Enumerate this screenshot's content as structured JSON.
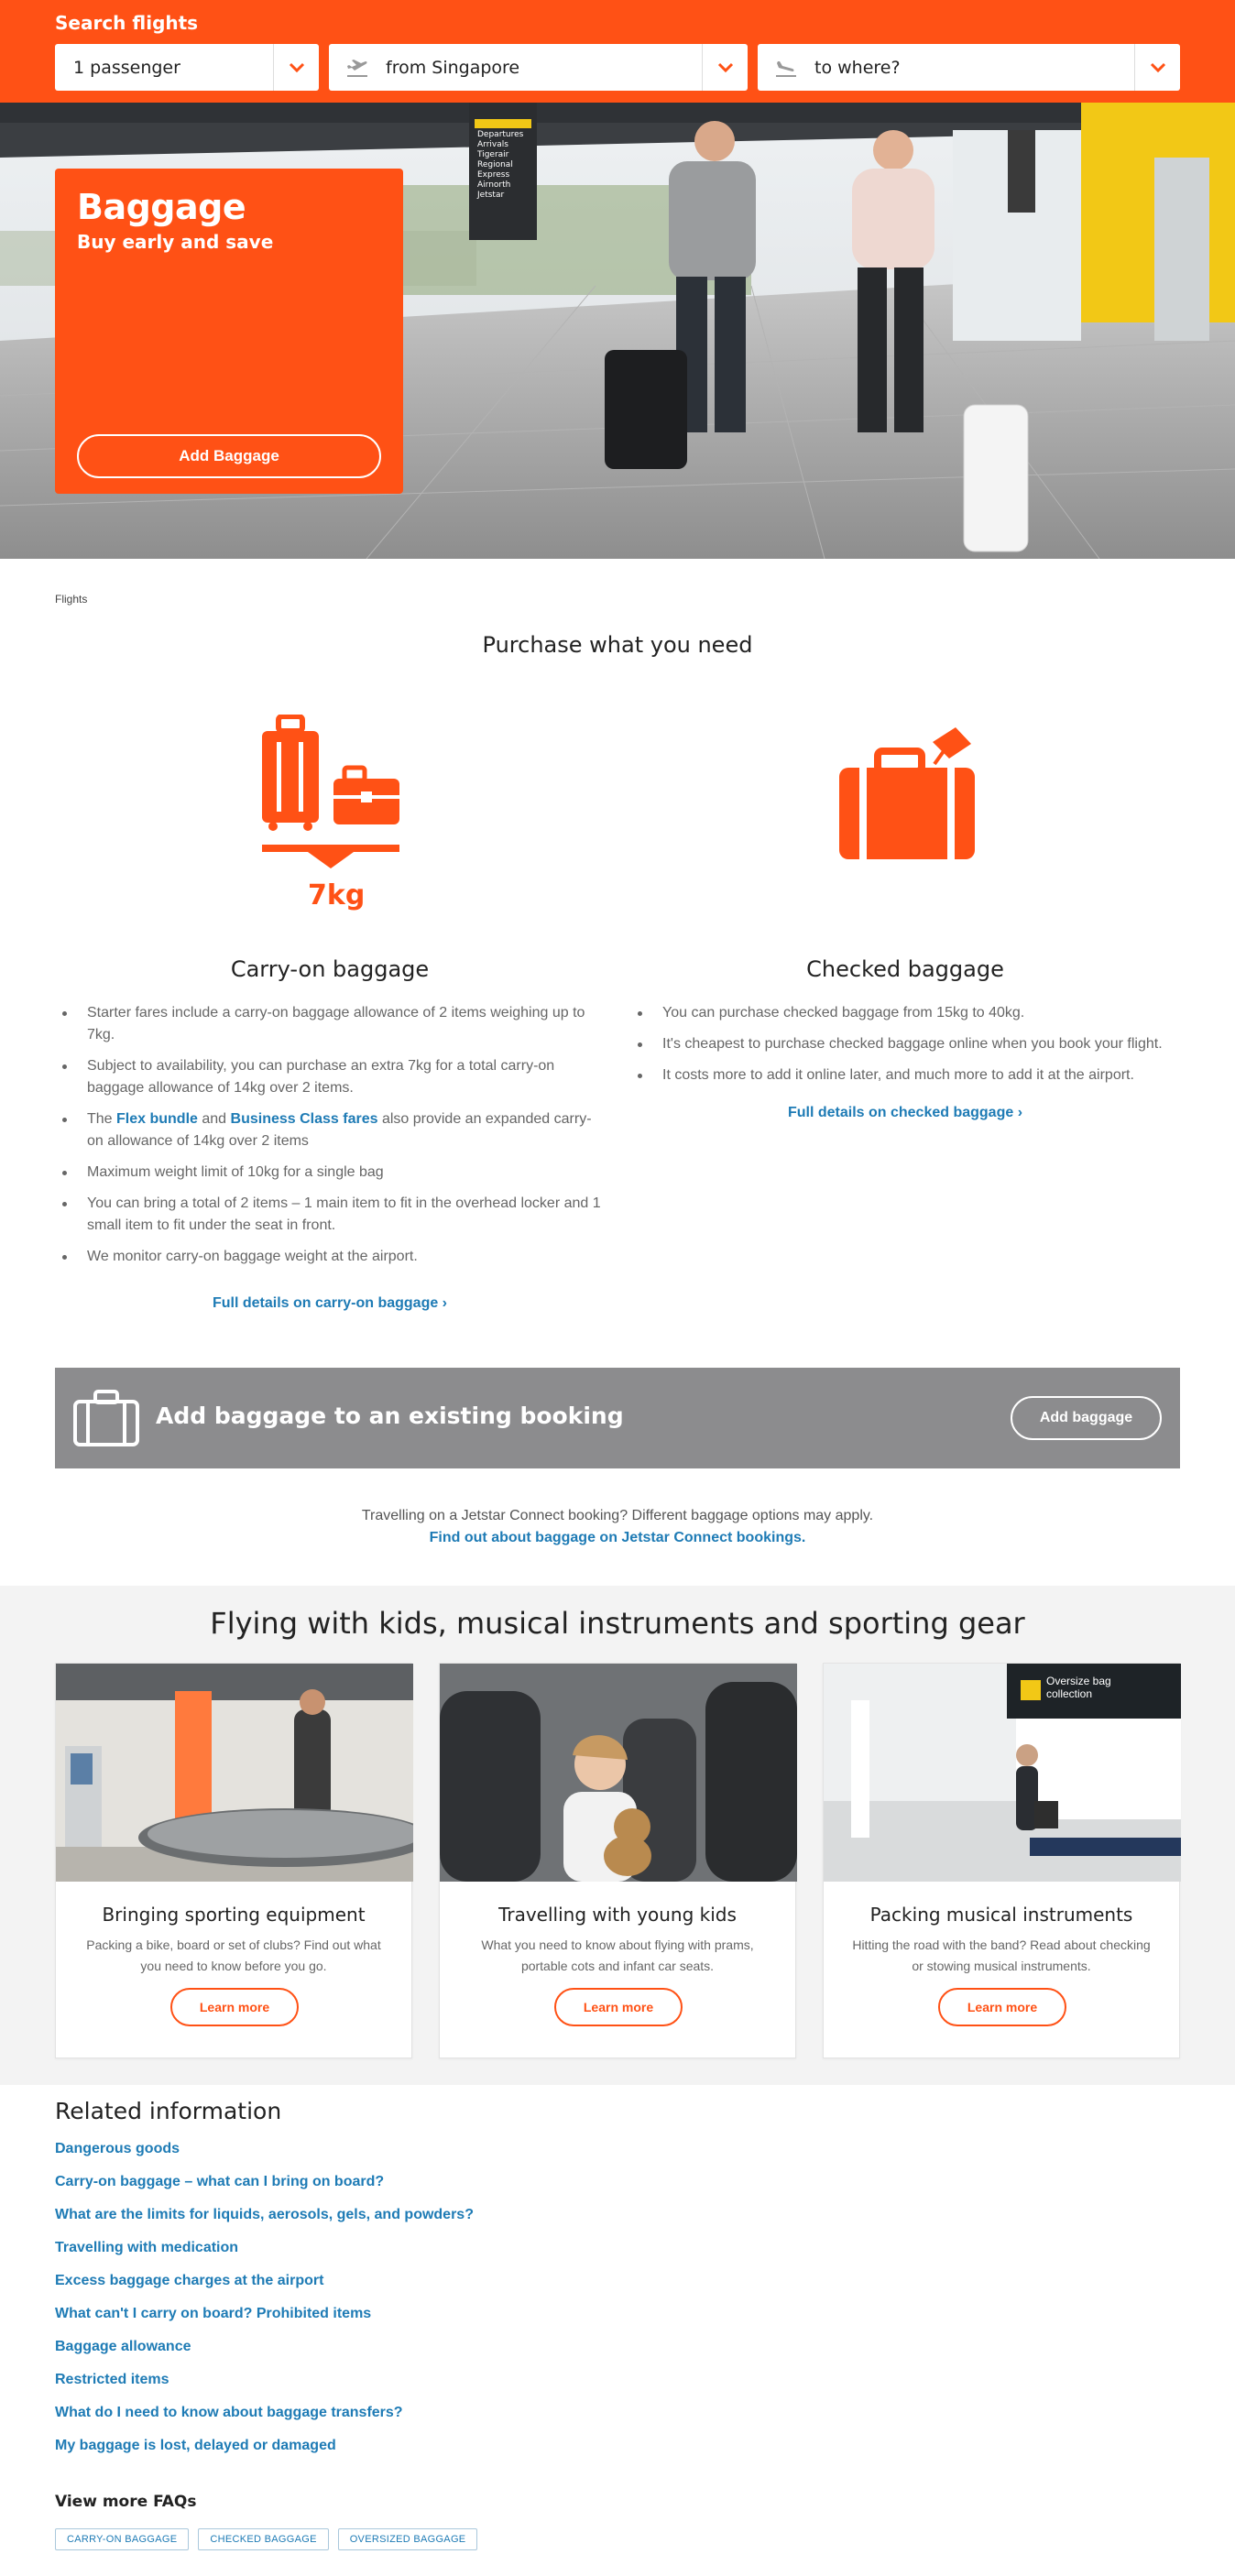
{
  "search": {
    "title": "Search flights",
    "passengers": "1 passenger",
    "from": "from Singapore",
    "to": "to where?"
  },
  "hero": {
    "title": "Baggage",
    "subtitle": "Buy early and save",
    "button": "Add Baggage",
    "sign_lines": [
      "Departures",
      "Arrivals",
      "Tigerair",
      "Regional",
      "Express",
      "Airnorth",
      "Jetstar"
    ]
  },
  "breadcrumb": "Flights",
  "purchase": {
    "title": "Purchase what you need",
    "carry_on": {
      "icon_label": "7kg",
      "title": "Carry-on baggage",
      "items": [
        {
          "text": "Starter fares include a carry-on baggage allowance of 2 items weighing up to 7kg."
        },
        {
          "text": "Subject to availability, you can purchase an extra 7kg for a total carry-on baggage allowance of 14kg over 2 items."
        },
        {
          "pre": "The ",
          "link1": "Flex bundle",
          "mid": " and ",
          "link2": "Business Class fares",
          "post": " also provide an expanded carry-on allowance of 14kg over 2 items"
        },
        {
          "text": "Maximum weight limit of 10kg for a single bag"
        },
        {
          "text": "You can bring a total of 2 items – 1 main item to fit in the overhead locker and 1 small item to fit under the seat in front."
        },
        {
          "text": "We monitor carry-on baggage weight at the airport."
        }
      ],
      "link": "Full details on carry-on baggage ›"
    },
    "checked": {
      "title": "Checked baggage",
      "items": [
        "You can purchase checked baggage from 15kg to 40kg.",
        "It's cheapest to purchase checked baggage online when you book your flight.",
        "It costs more to add it online later, and much more to add it at the airport."
      ],
      "link": "Full details on checked baggage ›"
    }
  },
  "add_banner": {
    "title": "Add baggage to an existing booking",
    "button": "Add baggage"
  },
  "connect": {
    "text": "Travelling on a Jetstar Connect booking? Different baggage options may apply.",
    "link": "Find out about baggage on Jetstar Connect bookings."
  },
  "special": {
    "title": "Flying with kids, musical instruments and sporting gear",
    "cards": [
      {
        "title": "Bringing sporting equipment",
        "text": "Packing a bike, board or set of clubs? Find out what you need to know before you go.",
        "button": "Learn more"
      },
      {
        "title": "Travelling with young kids",
        "text": "What you need to know about flying with prams, portable cots and infant car seats.",
        "button": "Learn more"
      },
      {
        "title": "Packing musical instruments",
        "text": "Hitting the road with the band? Read about checking or stowing musical instruments.",
        "button": "Learn more",
        "sign": "Oversize bag collection"
      }
    ]
  },
  "related": {
    "title": "Related information",
    "links": [
      "Dangerous goods",
      "Carry-on baggage – what can I bring on board?",
      "What are the limits for liquids, aerosols, gels, and powders?",
      "Travelling with medication",
      "Excess baggage charges at the airport",
      "What can't I carry on board? Prohibited items",
      "Baggage allowance",
      "Restricted items",
      "What do I need to know about baggage transfers?",
      "My baggage is lost, delayed or damaged"
    ]
  },
  "faqs": {
    "title": "View more FAQs",
    "tags": [
      "CARRY-ON BAGGAGE",
      "CHECKED BAGGAGE",
      "OVERSIZED BAGGAGE"
    ]
  },
  "colors": {
    "brand_orange": "#ff5115",
    "link_blue": "#1e7bb5",
    "banner_grey": "#8c8c8e",
    "band_grey": "#f3f3f3"
  }
}
